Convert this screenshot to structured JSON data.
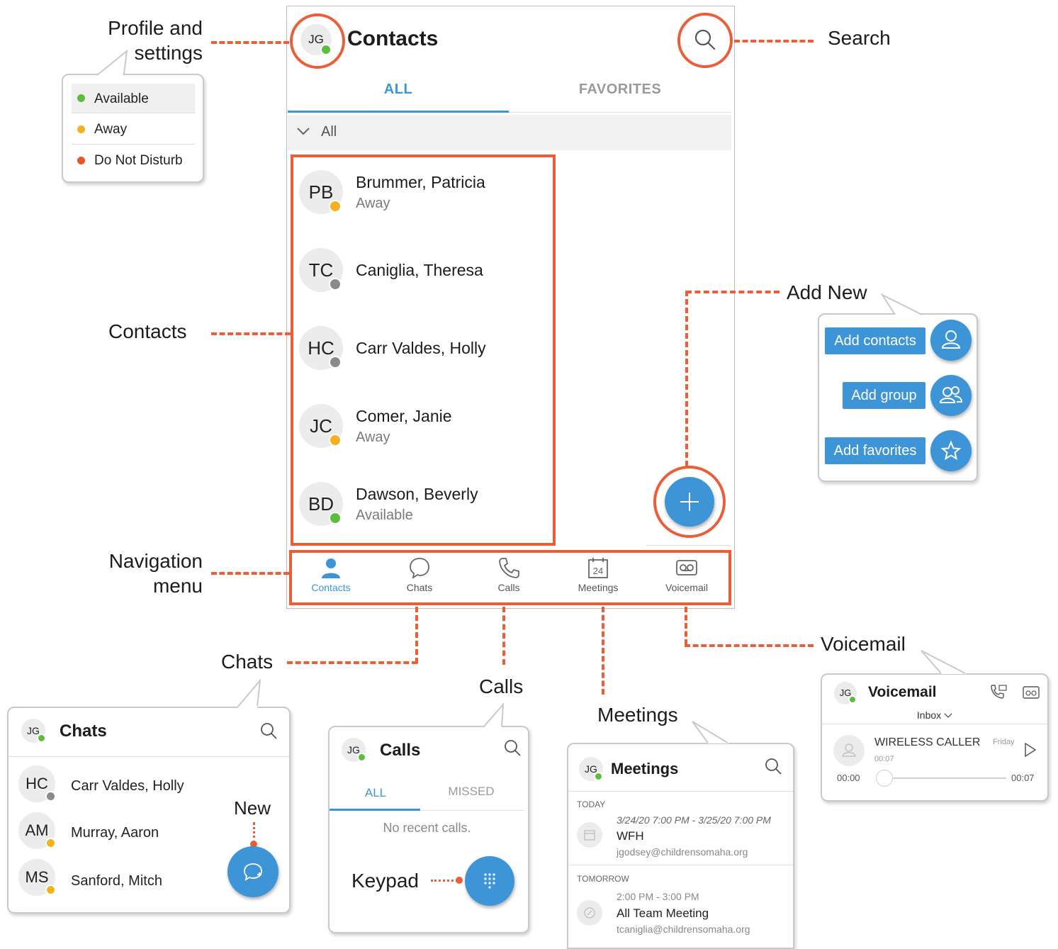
{
  "callouts": {
    "profile": "Profile and\nsettings",
    "search": "Search",
    "contacts": "Contacts",
    "add_new": "Add New",
    "navigation": "Navigation\nmenu",
    "chats": "Chats",
    "calls": "Calls",
    "meetings": "Meetings",
    "voicemail": "Voicemail",
    "new": "New",
    "keypad": "Keypad"
  },
  "status_menu": {
    "items": [
      {
        "label": "Available",
        "color": "#5bbf3d"
      },
      {
        "label": "Away",
        "color": "#f2b221"
      },
      {
        "label": "Do Not Disturb",
        "color": "#ea5525"
      }
    ]
  },
  "phone": {
    "avatar_initials": "JG",
    "title": "Contacts",
    "tabs": [
      "ALL",
      "FAVORITES"
    ],
    "active_tab": "ALL",
    "filter_label": "All",
    "contacts": [
      {
        "initials": "PB",
        "name": "Brummer, Patricia",
        "status": "Away",
        "status_color": "#f2b221"
      },
      {
        "initials": "TC",
        "name": "Caniglia, Theresa",
        "status": "",
        "status_color": "#8a8a8a"
      },
      {
        "initials": "HC",
        "name": "Carr Valdes, Holly",
        "status": "",
        "status_color": "#8a8a8a"
      },
      {
        "initials": "JC",
        "name": "Comer, Janie",
        "status": "Away",
        "status_color": "#f2b221"
      },
      {
        "initials": "BD",
        "name": "Dawson, Beverly",
        "status": "Available",
        "status_color": "#5bbf3d"
      }
    ],
    "fab_icon": "plus-icon",
    "nav": [
      {
        "label": "Contacts",
        "icon": "person-icon",
        "active": true
      },
      {
        "label": "Chats",
        "icon": "chat-bubble-icon",
        "active": false
      },
      {
        "label": "Calls",
        "icon": "phone-icon",
        "active": false
      },
      {
        "label": "Meetings",
        "icon": "calendar-icon",
        "active": false,
        "badge": "24"
      },
      {
        "label": "Voicemail",
        "icon": "voicemail-icon",
        "active": false
      }
    ]
  },
  "add_new_menu": {
    "items": [
      {
        "label": "Add contacts",
        "icon": "person-icon"
      },
      {
        "label": "Add group",
        "icon": "group-icon"
      },
      {
        "label": "Add favorites",
        "icon": "star-icon"
      }
    ]
  },
  "chats_panel": {
    "avatar": "JG",
    "title": "Chats",
    "items": [
      {
        "initials": "HC",
        "name": "Carr Valdes, Holly",
        "status_color": "#8a8a8a"
      },
      {
        "initials": "AM",
        "name": "Murray, Aaron",
        "status_color": "#f2b221"
      },
      {
        "initials": "MS",
        "name": "Sanford, Mitch",
        "status_color": "#f2b221"
      }
    ]
  },
  "calls_panel": {
    "avatar": "JG",
    "title": "Calls",
    "tabs": [
      "ALL",
      "MISSED"
    ],
    "empty_text": "No recent calls."
  },
  "meetings_panel": {
    "avatar": "JG",
    "title": "Meetings",
    "groups": [
      {
        "heading": "TODAY",
        "time": "3/24/20 7:00 PM - 3/25/20 7:00 PM",
        "title": "WFH",
        "email": "jgodsey@childrensomaha.org"
      },
      {
        "heading": "TOMORROW",
        "time": "2:00 PM - 3:00 PM",
        "title": "All Team Meeting",
        "email": "tcaniglia@childrensomaha.org"
      }
    ]
  },
  "voicemail_panel": {
    "avatar": "JG",
    "title": "Voicemail",
    "folder": "Inbox",
    "caller": "WIRELESS CALLER",
    "day": "Friday",
    "duration": "00:07",
    "elapsed": "00:00",
    "total": "00:07",
    "progress": 0
  }
}
